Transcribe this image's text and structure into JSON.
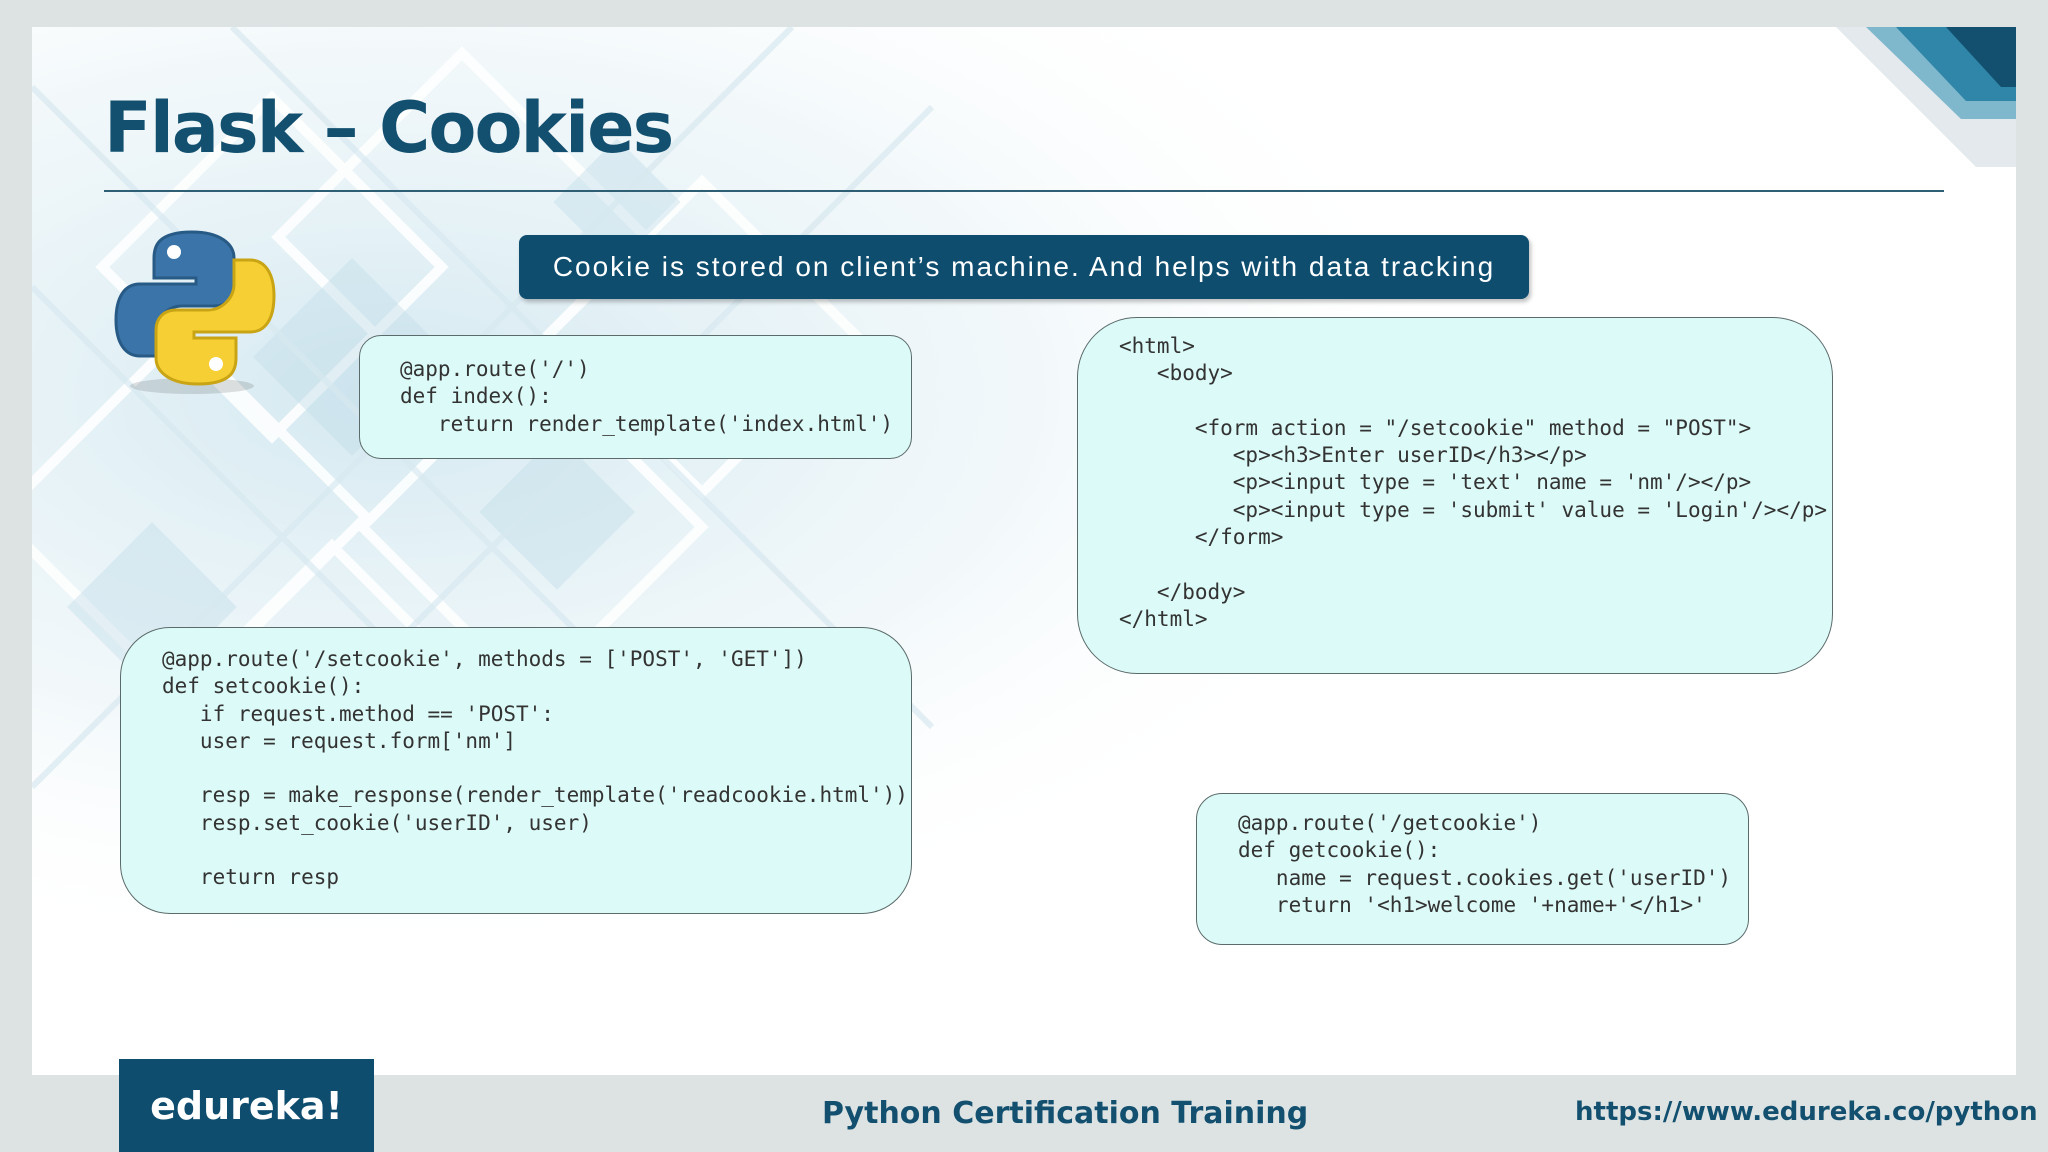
{
  "slide": {
    "title": "Flask – Cookies",
    "banner_text": "Cookie is stored on client’s machine. And helps with data tracking"
  },
  "code_blocks": {
    "index_route": "@app.route('/')\ndef index():\n   return render_template('index.html')",
    "index_html": "<html>\n   <body>\n\n      <form action = \"/setcookie\" method = \"POST\">\n         <p><h3>Enter userID</h3></p>\n         <p><input type = 'text' name = 'nm'/></p>\n         <p><input type = 'submit' value = 'Login'/></p>\n      </form>\n\n   </body>\n</html>",
    "setcookie_route": "@app.route('/setcookie', methods = ['POST', 'GET'])\ndef setcookie():\n   if request.method == 'POST':\n   user = request.form['nm']\n\n   resp = make_response(render_template('readcookie.html'))\n   resp.set_cookie('userID', user)\n\n   return resp",
    "getcookie_route": "@app.route('/getcookie')\ndef getcookie():\n   name = request.cookies.get('userID')\n   return '<h1>welcome '+name+'</h1>'"
  },
  "footer": {
    "brand": "edureka!",
    "course": "Python Certification Training",
    "url": "https://www.edureka.co/python"
  },
  "colors": {
    "title": "#13506f",
    "banner_bg": "#0e4d6e",
    "code_box_bg": "#dcfaf7"
  },
  "icons": [
    "python-logo-icon"
  ]
}
